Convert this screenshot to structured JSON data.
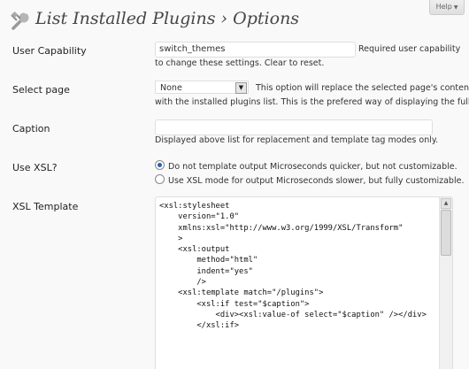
{
  "help": {
    "label": "Help",
    "icon": "triangle-down-icon"
  },
  "page": {
    "title": "List Installed Plugins › Options",
    "icon": "wrench-plugins-icon"
  },
  "fields": {
    "capability": {
      "label": "User Capability",
      "value": "switch_themes",
      "desc_line1": "Required user capability",
      "desc_line2": "to change these settings. Clear to reset."
    },
    "select_page": {
      "label": "Select page",
      "selected": "None",
      "desc_line1": "This option will replace the selected page's content",
      "desc_line2": "with the installed plugins list. This is the prefered way of displaying the full list."
    },
    "caption": {
      "label": "Caption",
      "value": "",
      "desc": "Displayed above list for replacement and template tag modes only."
    },
    "use_xsl": {
      "label": "Use XSL?",
      "option1": "Do not template output",
      "option1_note": "Microseconds quicker, but not customizable.",
      "option2": "Use XSL mode for output",
      "option2_note": "Microseconds slower, but fully customizable."
    },
    "xsl_template": {
      "label": "XSL Template",
      "lines": [
        "<xsl:stylesheet",
        "    version=\"1.0\"",
        "    xmlns:xsl=\"http://www.w3.org/1999/XSL/Transform\"",
        "    >",
        "",
        "    <xsl:output",
        "        method=\"html\"",
        "        indent=\"yes\"",
        "        />",
        "",
        "    <xsl:template match=\"/plugins\">",
        "",
        "        <xsl:if test=\"$caption\">",
        "            <div><xsl:value-of select=\"$caption\" /></div>",
        "        </xsl:if>"
      ]
    }
  }
}
